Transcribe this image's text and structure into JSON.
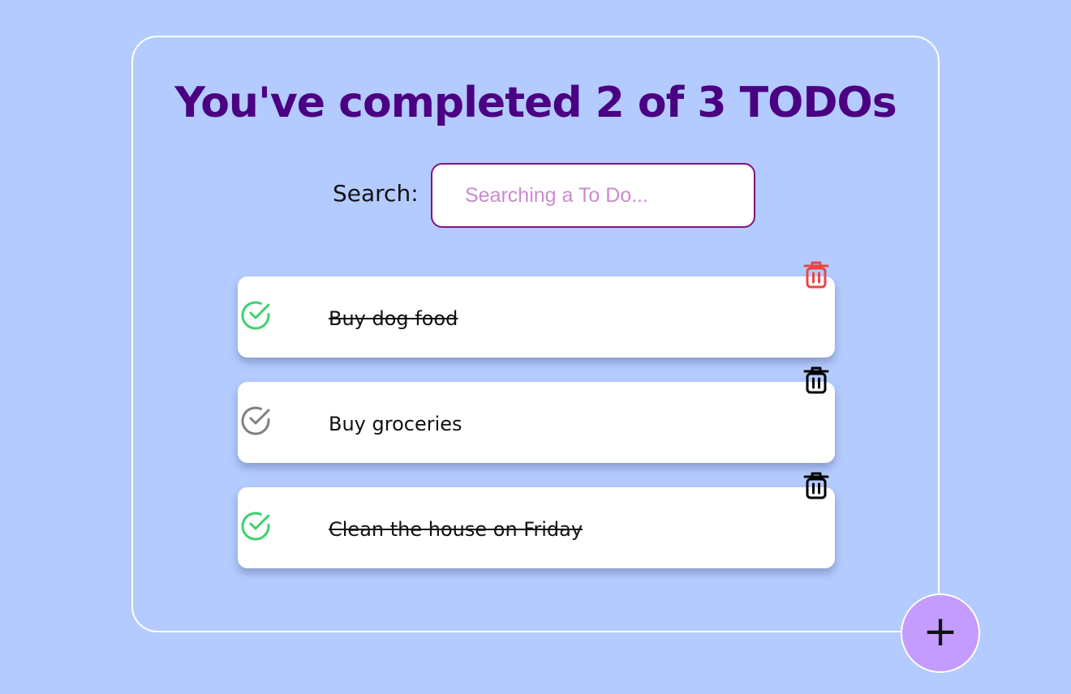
{
  "header": {
    "title": "You've completed 2 of 3 TODOs"
  },
  "search": {
    "label": "Search:",
    "placeholder": "Searching a To Do...",
    "value": ""
  },
  "todos": [
    {
      "text": "Buy dog food",
      "completed": true,
      "check_icon": "check-circle-icon",
      "delete_icon": "trash-icon",
      "delete_color": "#ef4444"
    },
    {
      "text": "Buy groceries",
      "completed": false,
      "check_icon": "check-circle-icon",
      "delete_icon": "trash-icon",
      "delete_color": "#000000"
    },
    {
      "text": "Clean the house on Friday",
      "completed": true,
      "check_icon": "check-circle-icon",
      "delete_icon": "trash-icon",
      "delete_color": "#000000"
    }
  ],
  "add_button": {
    "label": "+",
    "icon": "plus-icon"
  },
  "colors": {
    "background": "#b3cbff",
    "title": "#4b0082",
    "completed_check": "#3dd26e",
    "pending_check": "#808080",
    "add_button": "#c49cff"
  }
}
